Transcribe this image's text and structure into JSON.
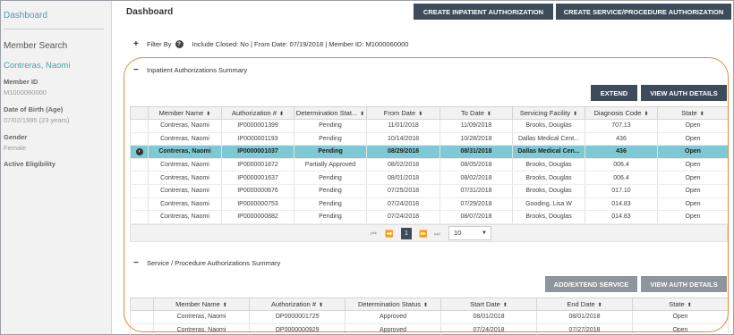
{
  "sidebar": {
    "dashboard_link": "Dashboard",
    "member_search": "Member Search",
    "member_name": "Contreras, Naomi",
    "member_id_label": "Member ID",
    "member_id_value": "M1000060000",
    "dob_label": "Date of Birth (Age)",
    "dob_value": "07/02/1995 (23 years)",
    "gender_label": "Gender",
    "gender_value": "Female",
    "eligibility_label": "Active Eligibility"
  },
  "header": {
    "title": "Dashboard",
    "create_inpatient": "CREATE INPATIENT AUTHORIZATION",
    "create_service": "CREATE SERVICE/PROCEDURE AUTHORIZATION"
  },
  "filter": {
    "label": "Filter By",
    "summary": "Include Closed: No | From Date: 07/19/2018 | Member ID: M1000060000"
  },
  "inpatient": {
    "title": "Inpatient Authorizations Summary",
    "extend": "EXTEND",
    "view_details": "VIEW AUTH DETAILS",
    "columns": [
      "Member Name",
      "Authorization #",
      "Determination Stat...",
      "From Date",
      "To Date",
      "Servicing Facility",
      "Diagnosis Code",
      "State"
    ],
    "rows": [
      [
        "Contreras, Naomi",
        "IP0000001399",
        "Pending",
        "11/01/2018",
        "11/09/2018",
        "Brooks, Douglas",
        "707.13",
        "Open"
      ],
      [
        "Contreras, Naomi",
        "IP0000001193",
        "Pending",
        "10/14/2018",
        "10/28/2018",
        "Dallas Medical Cent...",
        "436",
        "Open"
      ],
      [
        "Contreras, Naomi",
        "IP0000001037",
        "Pending",
        "08/29/2018",
        "08/31/2018",
        "Dallas Medical Cen...",
        "436",
        "Open"
      ],
      [
        "Contreras, Naomi",
        "IP0000001872",
        "Partially Approved",
        "08/02/2018",
        "08/05/2018",
        "Brooks, Douglas",
        "006.4",
        "Open"
      ],
      [
        "Contreras, Naomi",
        "IP0000001637",
        "Pending",
        "08/01/2018",
        "08/02/2018",
        "Brooks, Douglas",
        "006.4",
        "Open"
      ],
      [
        "Contreras, Naomi",
        "IP0000000676",
        "Pending",
        "07/25/2018",
        "07/31/2018",
        "Brooks, Douglas",
        "017.10",
        "Open"
      ],
      [
        "Contreras, Naomi",
        "IP0000000753",
        "Pending",
        "07/24/2018",
        "07/29/2018",
        "Gooding, Lisa W",
        "014.83",
        "Open"
      ],
      [
        "Contreras, Naomi",
        "IP0000000882",
        "Pending",
        "07/24/2018",
        "08/07/2018",
        "Brooks, Douglas",
        "014.83",
        "Open"
      ]
    ],
    "selected_row": 2,
    "pager": {
      "current_page": "1",
      "page_size": "10"
    }
  },
  "service": {
    "title": "Service / Procedure Authorizations Summary",
    "add_extend": "ADD/EXTEND SERVICE",
    "view_details": "VIEW AUTH DETAILS",
    "columns": [
      "Member Name",
      "Authorization #",
      "Determination Status",
      "Start Date",
      "End Date",
      "State"
    ],
    "rows": [
      [
        "Contreras, Naomi",
        "OP0000001725",
        "Approved",
        "08/01/2018",
        "08/01/2018",
        "Open"
      ],
      [
        "Contreras, Naomi",
        "OP0000000929",
        "Approved",
        "07/24/2018",
        "07/27/2018",
        "Open"
      ]
    ]
  },
  "icons": {
    "sort": "sort-icon",
    "select_row": "row-select-icon",
    "help": "help-icon"
  },
  "colors": {
    "accent": "#4f9ea8",
    "button_dark": "#3e4b5b",
    "button_grey": "#8f959b",
    "selected_row": "#7fc9d4",
    "highlight": "#e08a3c"
  }
}
